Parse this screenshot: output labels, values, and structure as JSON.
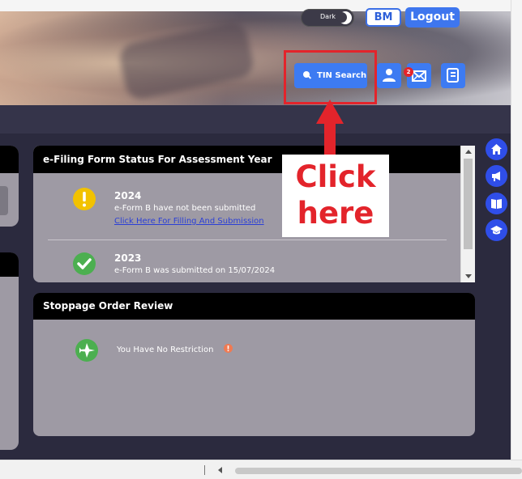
{
  "header": {
    "theme_toggle_label": "Dark",
    "user_initials": "BM",
    "logout_label": "Logout",
    "tin_search_label": "TIN Search",
    "notification_count": "2"
  },
  "efiling": {
    "title": "e-Filing Form Status For Assessment Year",
    "entries": [
      {
        "year": "2024",
        "status": "e-Form B have not been submitted",
        "link": "Click Here For Filling And Submission"
      },
      {
        "year": "2023",
        "status": "e-Form B was submitted on 15/07/2024"
      }
    ]
  },
  "stoppage": {
    "title": "Stoppage Order Review",
    "message": "You Have No Restriction"
  },
  "annotation": {
    "line1": "Click",
    "line2": "here"
  },
  "colors": {
    "accent": "#3d7bf2",
    "annotation_red": "#e3242b",
    "panel_bg": "#9e9aa4",
    "page_bg": "#2b2a3e",
    "success_green": "#4caf50",
    "warning_yellow": "#f2c200"
  }
}
